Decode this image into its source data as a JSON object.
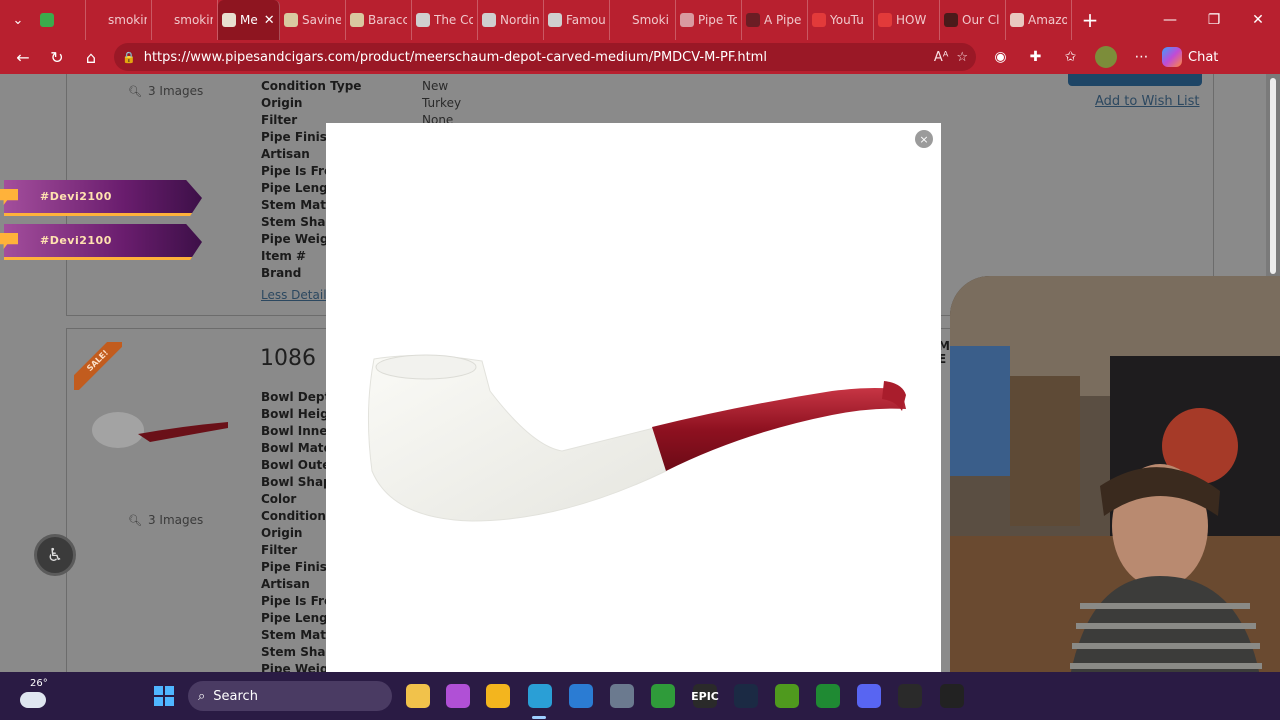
{
  "browser": {
    "tabs": [
      {
        "label": "",
        "fav_color": "#3cab4c",
        "state": "normal"
      },
      {
        "label": "smokin",
        "fav_color": "#b8202f",
        "state": "normal"
      },
      {
        "label": "smokin",
        "fav_color": "#b8202f",
        "state": "normal"
      },
      {
        "label": "Me",
        "fav_color": "#e8e0d0",
        "state": "active"
      },
      {
        "label": "Savinel",
        "fav_color": "#d9c9a0",
        "state": "normal"
      },
      {
        "label": "Baracc",
        "fav_color": "#d9c9a0",
        "state": "normal"
      },
      {
        "label": "The Co",
        "fav_color": "#cfcfcf",
        "state": "normal"
      },
      {
        "label": "Nordin",
        "fav_color": "#cfcfcf",
        "state": "normal"
      },
      {
        "label": "Famou",
        "fav_color": "#cfcfcf",
        "state": "normal"
      },
      {
        "label": "Smoki",
        "fav_color": "#b8202f",
        "state": "normal"
      },
      {
        "label": "Pipe To",
        "fav_color": "#d99aa0",
        "state": "normal"
      },
      {
        "label": "A Pipe",
        "fav_color": "#6b1d24",
        "state": "normal"
      },
      {
        "label": "YouTu",
        "fav_color": "#e23a3a",
        "state": "normal"
      },
      {
        "label": "HOW",
        "fav_color": "#e23a3a",
        "state": "normal"
      },
      {
        "label": "Our Cl",
        "fav_color": "#4b1a1a",
        "state": "normal"
      },
      {
        "label": "Amazo",
        "fav_color": "#e8c9c0",
        "state": "normal"
      }
    ],
    "url": "https://www.pipesandcigars.com/product/meerschaum-depot-carved-medium/PMDCV-M-PF.html",
    "chat_label": "Chat"
  },
  "page": {
    "images_label": "3 Images",
    "card1_specs": {
      "labels": [
        "Condition Type",
        "Origin",
        "Filter",
        "Pipe Finish",
        "Artisan",
        "Pipe Is Fre",
        "Pipe Lengt",
        "Stem Mate",
        "Stem Shap",
        "Pipe Weigl",
        "Item #",
        "Brand"
      ],
      "values": [
        "New",
        "Turkey",
        "None"
      ]
    },
    "less_details": "Less Details",
    "wishlist": "Add to Wish List",
    "product_number": "1086",
    "sale_label": "SALE!",
    "card2_specs": {
      "labels": [
        "Bowl Dept",
        "Bowl Heigl",
        "Bowl Inne",
        "Bowl Mate",
        "Bowl Oute",
        "Bowl Shap",
        "Color",
        "Condition",
        "Origin",
        "Filter",
        "Pipe Finish",
        "Artisan",
        "Pipe Is Fre",
        "Pipe Lengt",
        "Stem Mate",
        "Stem Shap",
        "Pipe Weigl"
      ]
    },
    "peek_text": [
      "MSP",
      "E A"
    ]
  },
  "overlay": {
    "tags": [
      "#Devi2100",
      "#Devi2100"
    ]
  },
  "modal": {
    "close_symbol": "×"
  },
  "taskbar": {
    "temperature": "26°",
    "search_label": "Search",
    "apps": [
      {
        "name": "file-explorer",
        "color": "#f1c24b",
        "label": ""
      },
      {
        "name": "copilot",
        "color": "#b050d6",
        "label": ""
      },
      {
        "name": "folder",
        "color": "#f3b51e",
        "label": ""
      },
      {
        "name": "edge",
        "color": "#2a9fd6",
        "label": ""
      },
      {
        "name": "outlook",
        "color": "#2b7cd3",
        "label": ""
      },
      {
        "name": "settings",
        "color": "#6b7a8f",
        "label": ""
      },
      {
        "name": "xbox",
        "color": "#2f9b3a",
        "label": ""
      },
      {
        "name": "epic-games",
        "color": "#2a2a2a",
        "label": "EPIC"
      },
      {
        "name": "steam",
        "color": "#1b2a44",
        "label": ""
      },
      {
        "name": "nvidia",
        "color": "#4f9a1e",
        "label": ""
      },
      {
        "name": "game-bar",
        "color": "#1f8a33",
        "label": ""
      },
      {
        "name": "discord",
        "color": "#5865f2",
        "label": ""
      },
      {
        "name": "obs",
        "color": "#2a2a2a",
        "label": ""
      },
      {
        "name": "speedtest",
        "color": "#222222",
        "label": ""
      }
    ]
  }
}
